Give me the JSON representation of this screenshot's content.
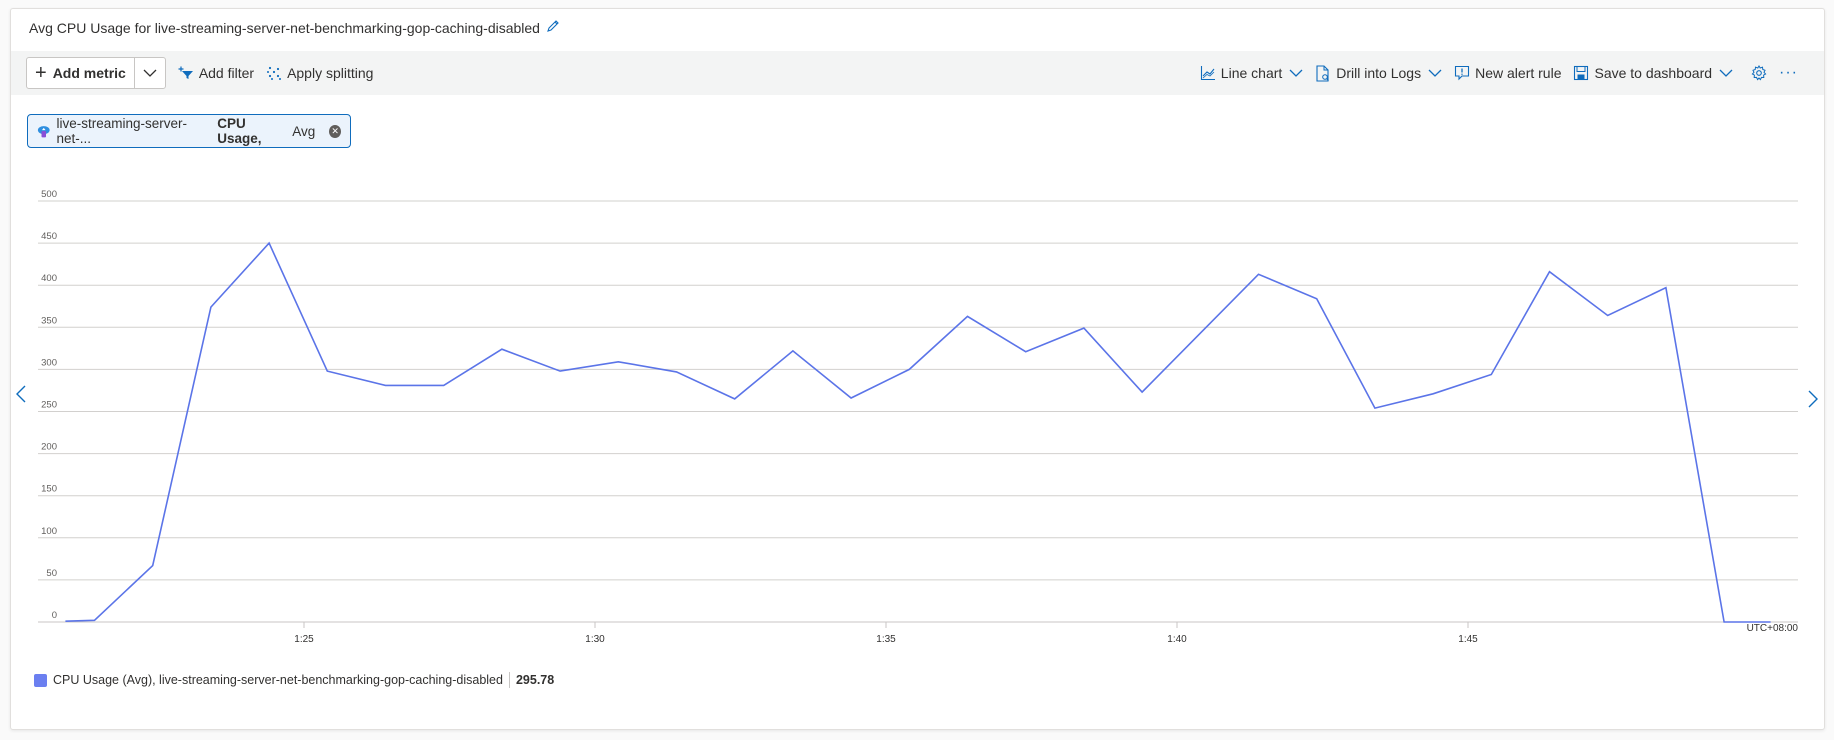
{
  "title": "Avg CPU Usage for live-streaming-server-net-benchmarking-gop-caching-disabled",
  "toolbar": {
    "add_metric": "Add metric",
    "add_filter": "Add filter",
    "apply_splitting": "Apply splitting",
    "line_chart": "Line chart",
    "drill_into_logs": "Drill into Logs",
    "new_alert_rule": "New alert rule",
    "save_to_dashboard": "Save to dashboard",
    "more": "···"
  },
  "metric_pill": {
    "resource": "live-streaming-server-net-...",
    "metric": "CPU Usage,",
    "aggregation": "Avg"
  },
  "legend": {
    "label": "CPU Usage (Avg), live-streaming-server-net-benchmarking-gop-caching-disabled",
    "value": "295.78",
    "color": "#6b7ff0"
  },
  "colors": {
    "accent": "#0f6cbd",
    "series": "#5b74e8",
    "grid": "#d2d0ce"
  },
  "chart_data": {
    "type": "line",
    "title": "Avg CPU Usage for live-streaming-server-net-benchmarking-gop-caching-disabled",
    "xlabel": "",
    "ylabel": "",
    "timezone_label": "UTC+08:00",
    "ylim": [
      0,
      500
    ],
    "yticks": [
      0,
      50,
      100,
      150,
      200,
      250,
      300,
      350,
      400,
      450,
      500
    ],
    "xlim_minutes": [
      20.9,
      50.2
    ],
    "xticks": [
      {
        "label": "1:25",
        "minute": 25
      },
      {
        "label": "1:30",
        "minute": 30
      },
      {
        "label": "1:35",
        "minute": 35
      },
      {
        "label": "1:40",
        "minute": 40
      },
      {
        "label": "1:45",
        "minute": 45
      }
    ],
    "grid": true,
    "legend_position": "bottom-left",
    "series": [
      {
        "name": "CPU Usage (Avg), live-streaming-server-net-benchmarking-gop-caching-disabled",
        "x_minutes": [
          20.9,
          21.4,
          22.4,
          23.4,
          24.4,
          25.4,
          26.4,
          27.4,
          28.4,
          29.4,
          30.4,
          31.4,
          32.4,
          33.4,
          34.4,
          35.4,
          36.4,
          37.4,
          38.4,
          39.4,
          40.4,
          41.4,
          42.4,
          43.4,
          44.4,
          45.4,
          46.4,
          47.4,
          48.4,
          49.4,
          50.2
        ],
        "values": [
          1,
          2,
          67,
          374,
          450,
          298,
          281,
          281,
          324,
          298,
          309,
          297,
          265,
          322,
          266,
          300,
          363,
          321,
          349,
          273,
          343,
          413,
          384,
          254,
          271,
          294,
          416,
          364,
          397,
          0,
          0
        ]
      }
    ]
  }
}
